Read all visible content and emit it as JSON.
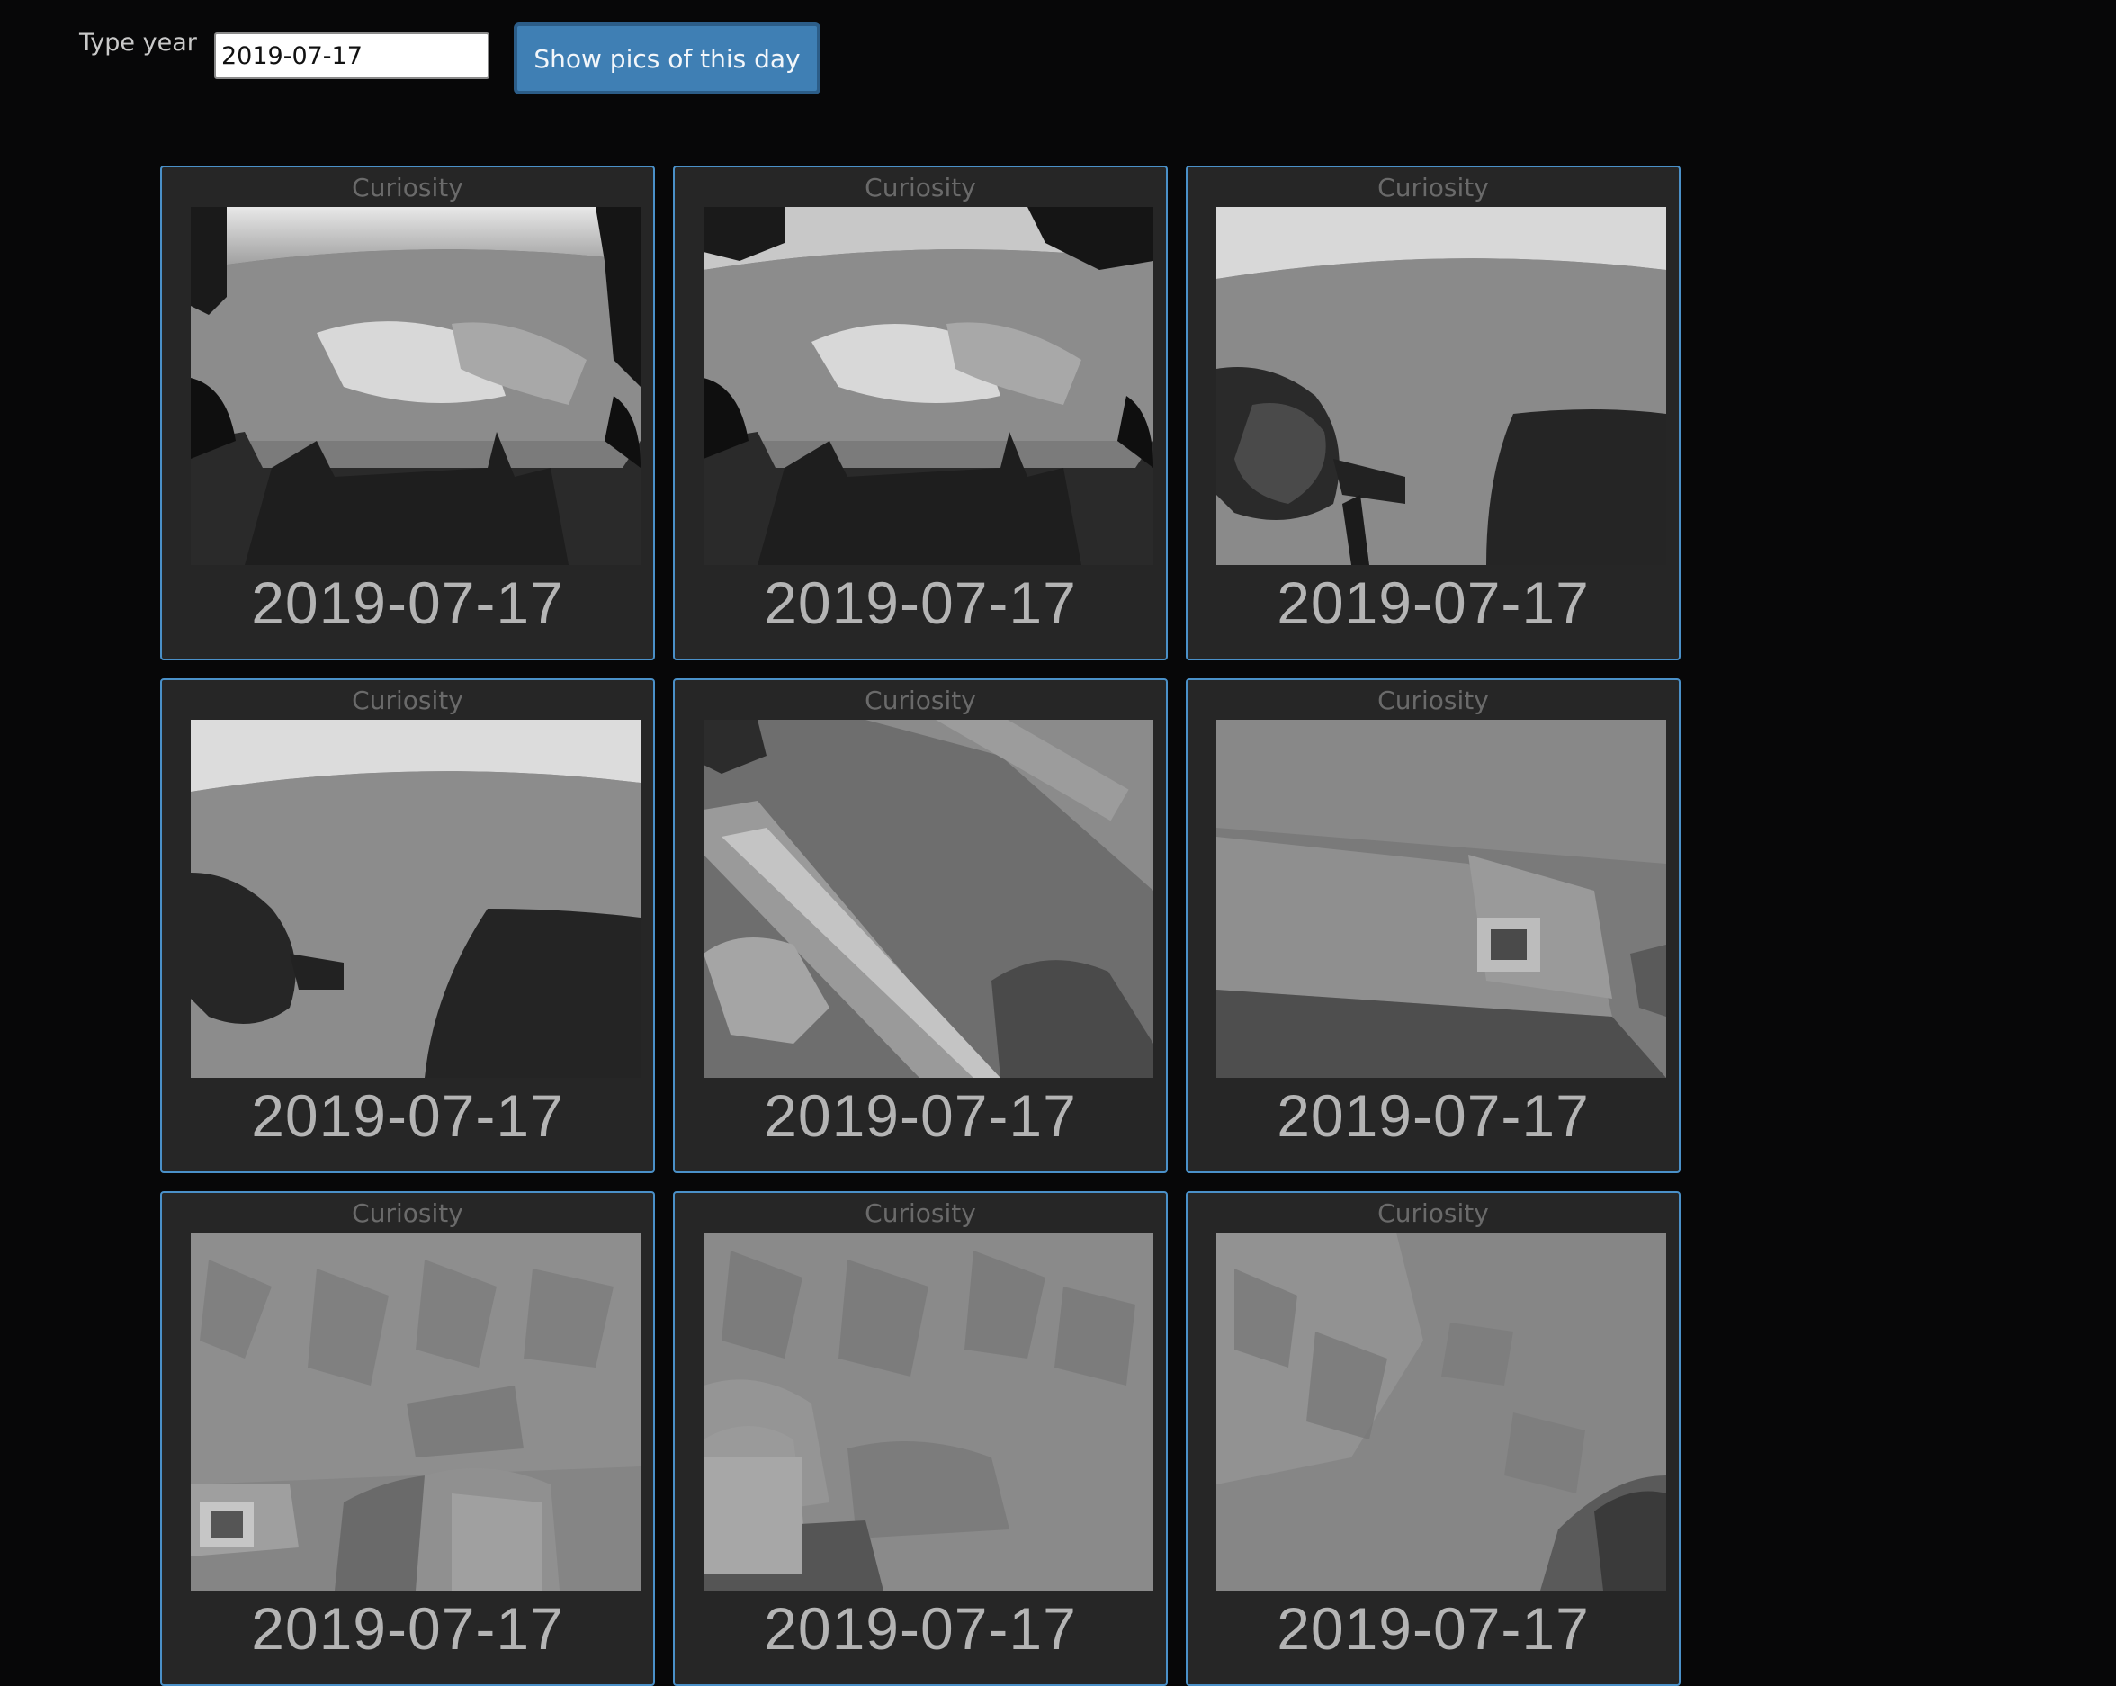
{
  "search": {
    "label": "Type year",
    "value": "2019-07-17",
    "button_label": "Show pics of this day"
  },
  "photos": [
    {
      "rover": "Curiosity",
      "earth_date": "2019-07-17",
      "scene": "hazcam-front-horizon-rocks"
    },
    {
      "rover": "Curiosity",
      "earth_date": "2019-07-17",
      "scene": "hazcam-front-horizon-rocks"
    },
    {
      "rover": "Curiosity",
      "earth_date": "2019-07-17",
      "scene": "hazcam-wheel-shadow"
    },
    {
      "rover": "Curiosity",
      "earth_date": "2019-07-17",
      "scene": "hazcam-wheel-shadow"
    },
    {
      "rover": "Curiosity",
      "earth_date": "2019-07-17",
      "scene": "rover-deck-closeup"
    },
    {
      "rover": "Curiosity",
      "earth_date": "2019-07-17",
      "scene": "rover-deck-closeup"
    },
    {
      "rover": "Curiosity",
      "earth_date": "2019-07-17",
      "scene": "cracked-bedrock-deck"
    },
    {
      "rover": "Curiosity",
      "earth_date": "2019-07-17",
      "scene": "cracked-bedrock-wheel"
    },
    {
      "rover": "Curiosity",
      "earth_date": "2019-07-17",
      "scene": "cracked-bedrock-wheel-edge"
    }
  ],
  "colors": {
    "background": "#070708",
    "card": "#262626",
    "card_border": "#4a90c8",
    "button": "#3f7fb4"
  }
}
